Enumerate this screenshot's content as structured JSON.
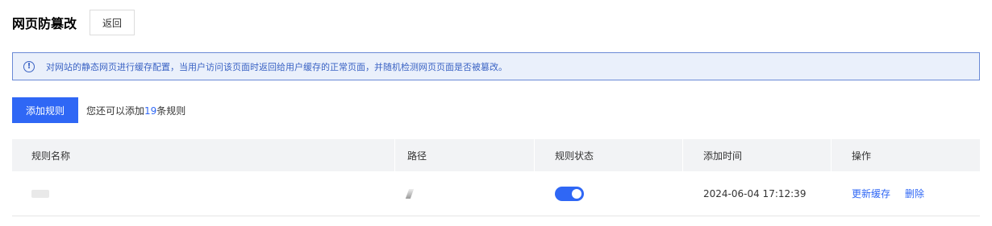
{
  "header": {
    "title": "网页防篡改",
    "back_label": "返回"
  },
  "notice": {
    "icon": "info-icon",
    "text": "对网站的静态网页进行缓存配置，当用户访问该页面时返回给用户缓存的正常页面，并随机检测网页页面是否被篡改。"
  },
  "actions": {
    "add_label": "添加规则",
    "hint_prefix": "您还可以添加",
    "hint_count": "19",
    "hint_suffix": "条规则"
  },
  "table": {
    "columns": [
      "规则名称",
      "路径",
      "规则状态",
      "添加时间",
      "操作"
    ],
    "rows": [
      {
        "status_enabled": true,
        "added_time": "2024-06-04 17:12:39",
        "ops": [
          "更新缓存",
          "删除"
        ]
      }
    ]
  },
  "colors": {
    "accent": "#2f67f5",
    "notice_bg": "#eaf0fb",
    "notice_border": "#6a8ad6",
    "header_bg": "#f2f3f5"
  }
}
